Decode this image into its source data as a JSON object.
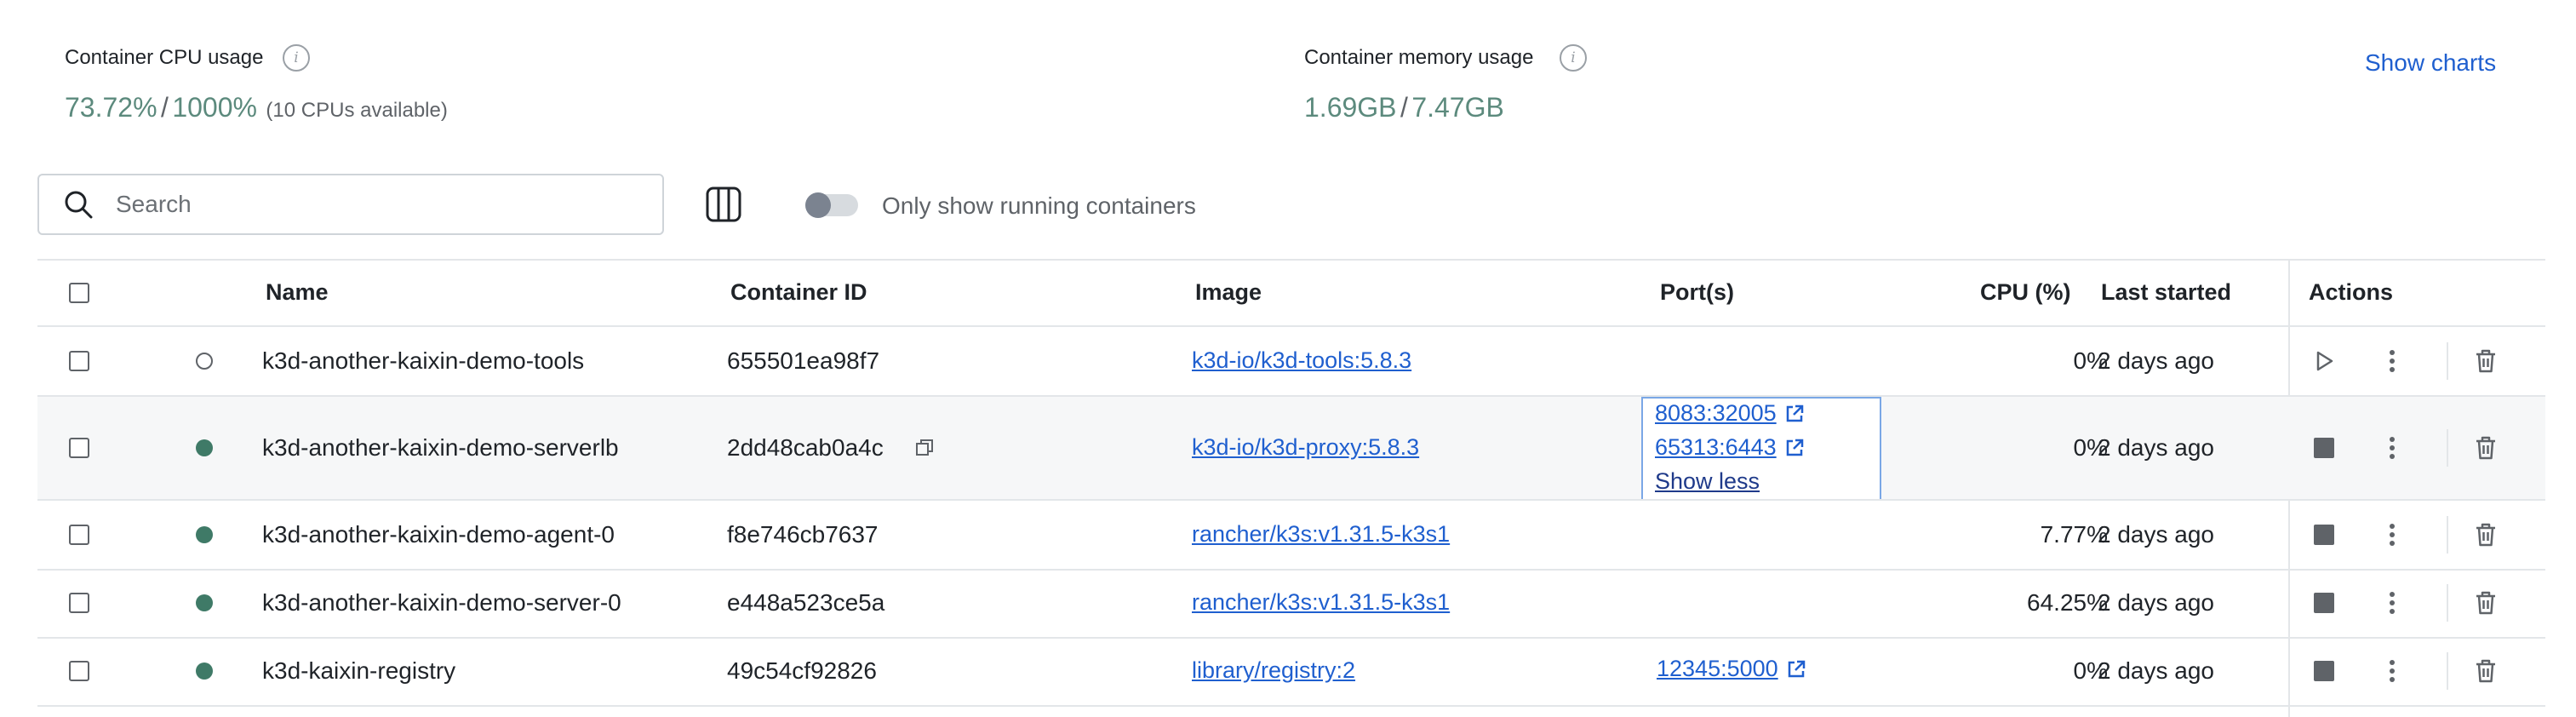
{
  "stats": {
    "cpu": {
      "label": "Container CPU usage",
      "value": "73.72%",
      "separator": "/",
      "total": "1000%",
      "sub": "(10 CPUs available)"
    },
    "memory": {
      "label": "Container memory usage",
      "value": "1.69GB",
      "separator": "/",
      "total": "7.47GB"
    },
    "show_charts": "Show charts"
  },
  "toolbar": {
    "search_placeholder": "Search",
    "toggle_label": "Only show running containers",
    "toggle_on": false
  },
  "table": {
    "columns": {
      "name": "Name",
      "container_id": "Container ID",
      "image": "Image",
      "ports": "Port(s)",
      "cpu": "CPU (%)",
      "last_started": "Last started",
      "actions": "Actions"
    },
    "rows": [
      {
        "name": "k3d-another-kaixin-demo-tools",
        "id": "655501ea98f7",
        "image": "k3d-io/k3d-tools:5.8.3",
        "ports": [],
        "cpu": "0%",
        "last_started": "2 days ago",
        "status": "stopped"
      },
      {
        "name": "k3d-another-kaixin-demo-serverlb",
        "id": "2dd48cab0a4c",
        "image": "k3d-io/k3d-proxy:5.8.3",
        "ports": [
          "8083:32005",
          "65313:6443"
        ],
        "show_less": "Show less",
        "cpu": "0%",
        "last_started": "2 days ago",
        "status": "running"
      },
      {
        "name": "k3d-another-kaixin-demo-agent-0",
        "id": "f8e746cb7637",
        "image": "rancher/k3s:v1.31.5-k3s1",
        "ports": [],
        "cpu": "7.77%",
        "last_started": "2 days ago",
        "status": "running"
      },
      {
        "name": "k3d-another-kaixin-demo-server-0",
        "id": "e448a523ce5a",
        "image": "rancher/k3s:v1.31.5-k3s1",
        "ports": [],
        "cpu": "64.25%",
        "last_started": "2 days ago",
        "status": "running"
      },
      {
        "name": "k3d-kaixin-registry",
        "id": "49c54cf92826",
        "image": "library/registry:2",
        "ports": [
          "12345:5000"
        ],
        "cpu": "0%",
        "last_started": "2 days ago",
        "status": "running"
      }
    ]
  },
  "icons": {
    "info": "info-icon",
    "search": "search-icon",
    "columns": "columns-icon",
    "copy": "copy-icon",
    "external_link": "external-link-icon",
    "play": "play-icon",
    "stop": "stop-icon",
    "more": "more-vertical-icon",
    "delete": "trash-icon"
  },
  "colors": {
    "accent": "#1f5fcf",
    "stat_value": "#5c8a7d",
    "running_dot": "#3f7a67",
    "row_highlight": "#f6f7f8"
  }
}
